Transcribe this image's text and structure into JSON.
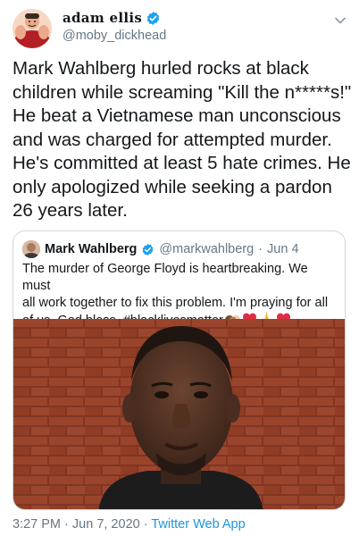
{
  "author": {
    "display_name": "adam ellis",
    "handle": "@moby_dickhead",
    "verified": true,
    "avatar_icon": "muscular-cartoon-avatar"
  },
  "tweet": {
    "lines": [
      "Mark Wahlberg hurled rocks at black",
      "children while screaming \"Kill the n*****s!\"",
      "He beat a Vietnamese man unconscious",
      "and was charged for attempted murder.",
      "He's committed at least 5 hate crimes. He",
      "only apologized while seeking a pardon",
      "26 years later."
    ]
  },
  "quoted_tweet": {
    "display_name": "Mark Wahlberg",
    "handle": "@markwahlberg",
    "separator": "·",
    "date": "Jun 4",
    "verified": true,
    "lines": [
      "The murder of George Floyd is heartbreaking. We must",
      "all work together to fix this problem. I'm praying for all",
      "of us. God bless. #blacklivesmatter"
    ],
    "emojis": [
      "handshake-emoji",
      "red-heart-emoji",
      "praying-hands-emoji",
      "red-heart-emoji"
    ],
    "image_icon": "portrait-photo-brick-wall"
  },
  "footer": {
    "time": "3:27 PM",
    "separator1": "·",
    "date": "Jun 7, 2020",
    "separator2": "·",
    "source": "Twitter Web App"
  },
  "colors": {
    "verified": "#1da1f2",
    "link": "#1b95e0",
    "secondary_text": "#657786",
    "border": "#ccd6dd"
  }
}
